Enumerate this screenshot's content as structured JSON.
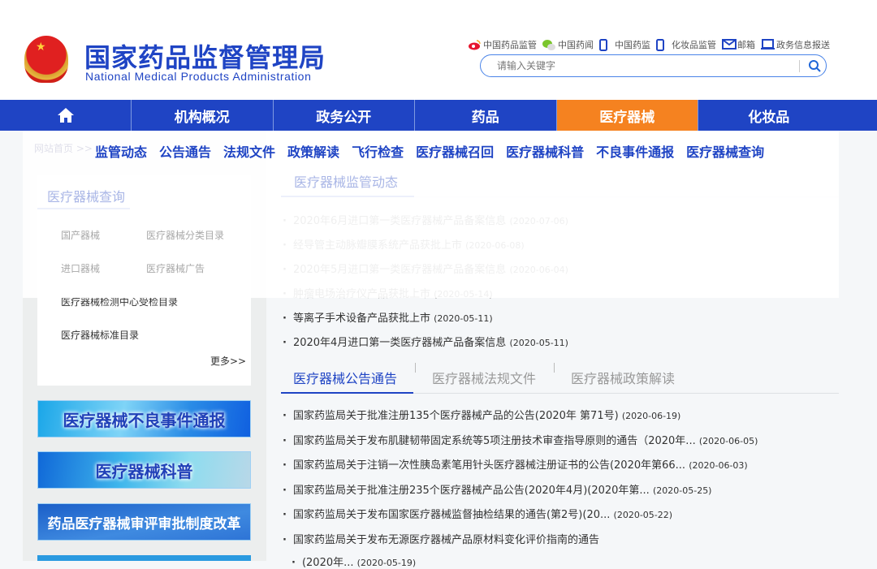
{
  "header": {
    "title_cn": "国家药品监督管理局",
    "title_en": "National Medical Products Administration",
    "top_links": [
      {
        "icon": "weibo-icon",
        "label": "中国药品监管"
      },
      {
        "icon": "wechat-icon",
        "label": "中国药闻"
      },
      {
        "icon": "mobile-icon",
        "label": "中国药监"
      },
      {
        "icon": "mobile-icon",
        "label": "化妆品监管"
      },
      {
        "icon": "mail-icon",
        "label": "邮箱"
      },
      {
        "icon": "monitor-icon",
        "label": "政务信息报送"
      }
    ],
    "search_placeholder": "请输入关键字"
  },
  "nav": {
    "items": [
      "机构概况",
      "政务公开",
      "药品",
      "医疗器械",
      "化妆品"
    ],
    "active": "医疗器械",
    "accent": "#f58220",
    "color": "#1f44c4"
  },
  "dropdown": {
    "items": [
      "监管动态",
      "公告通告",
      "法规文件",
      "政策解读",
      "飞行检查",
      "医疗器械召回",
      "医疗器械科普",
      "不良事件通报",
      "医疗器械查询"
    ]
  },
  "breadcrumb": "网站首页 >>",
  "left": {
    "title": "医疗器械查询",
    "links": [
      "国产器械",
      "医疗器械分类目录",
      "进口器械",
      "医疗器械广告",
      "医疗器械检测中心受检目录",
      "医疗器械标准目录"
    ],
    "more": "更多>>",
    "banners": [
      "医疗器械不良事件通报",
      "医疗器械科普",
      "药品医疗器械审评审批制度改革"
    ]
  },
  "supervision": {
    "title": "医疗器械监管动态",
    "items": [
      {
        "t": "2020年6月进口第一类医疗器械产品备案信息",
        "d": "(2020-07-06)"
      },
      {
        "t": "经导管主动脉瓣膜系统产品获批上市",
        "d": "(2020-06-08)"
      },
      {
        "t": "2020年5月进口第一类医疗器械产品备案信息",
        "d": "(2020-06-04)"
      },
      {
        "t": "肿瘤电场治疗仪产品获批上市",
        "d": "(2020-05-14)"
      },
      {
        "t": "等离子手术设备产品获批上市",
        "d": "(2020-05-11)"
      },
      {
        "t": "2020年4月进口第一类医疗器械产品备案信息",
        "d": "(2020-05-11)"
      }
    ]
  },
  "tabs": [
    "医疗器械公告通告",
    "医疗器械法规文件",
    "医疗器械政策解读"
  ],
  "notices": [
    {
      "t": "国家药监局关于批准注册135个医疗器械产品的公告(2020年 第71号)",
      "d": "(2020-06-19)"
    },
    {
      "t": "国家药监局关于发布肌腱韧带固定系统等5项注册技术审查指导原则的通告（2020年...",
      "d": "(2020-06-05)"
    },
    {
      "t": "国家药监局关于注销一次性胰岛素笔用针头医疗器械注册证书的公告(2020年第66...",
      "d": "(2020-06-03)"
    },
    {
      "t": "国家药监局关于批准注册235个医疗器械产品公告(2020年4月)(2020年第...",
      "d": "(2020-05-25)"
    },
    {
      "t": "国家药监局关于发布国家医疗器械监督抽检结果的通告(第2号)(20...",
      "d": "(2020-05-22)"
    },
    {
      "t": "国家药监局关于发布无源医疗器械产品原材料变化评价指南的通告",
      "d": ""
    }
  ],
  "notice_tail": {
    "t": "(2020年...",
    "d": "(2020-05-19)"
  }
}
